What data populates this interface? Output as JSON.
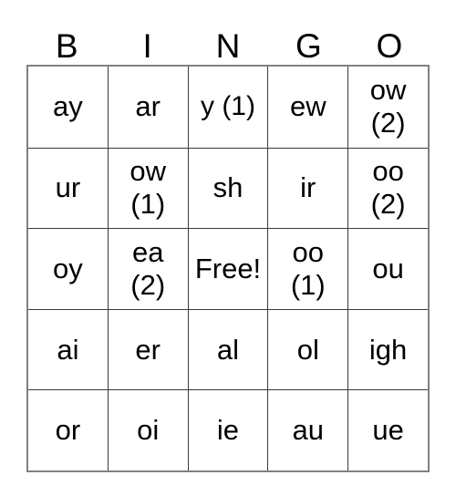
{
  "card": {
    "title": "BINGO",
    "headers": [
      "B",
      "I",
      "N",
      "G",
      "O"
    ],
    "free_space": "Free!",
    "colors": {
      "text": "#000000",
      "background": "#ffffff",
      "grid_line": "#3a3a3a",
      "outer_border": "#808080"
    },
    "rows": [
      [
        {
          "text": "ay"
        },
        {
          "text": "ar"
        },
        {
          "text": "y (1)"
        },
        {
          "text": "ew"
        },
        {
          "text": "ow\n(2)"
        }
      ],
      [
        {
          "text": "ur"
        },
        {
          "text": "ow\n(1)"
        },
        {
          "text": "sh"
        },
        {
          "text": "ir"
        },
        {
          "text": "oo\n(2)"
        }
      ],
      [
        {
          "text": "oy"
        },
        {
          "text": "ea\n(2)"
        },
        {
          "text": "Free!"
        },
        {
          "text": "oo\n(1)"
        },
        {
          "text": "ou"
        }
      ],
      [
        {
          "text": "ai"
        },
        {
          "text": "er"
        },
        {
          "text": "al"
        },
        {
          "text": "ol"
        },
        {
          "text": "igh"
        }
      ],
      [
        {
          "text": "or"
        },
        {
          "text": "oi"
        },
        {
          "text": "ie"
        },
        {
          "text": "au"
        },
        {
          "text": "ue"
        }
      ]
    ]
  }
}
